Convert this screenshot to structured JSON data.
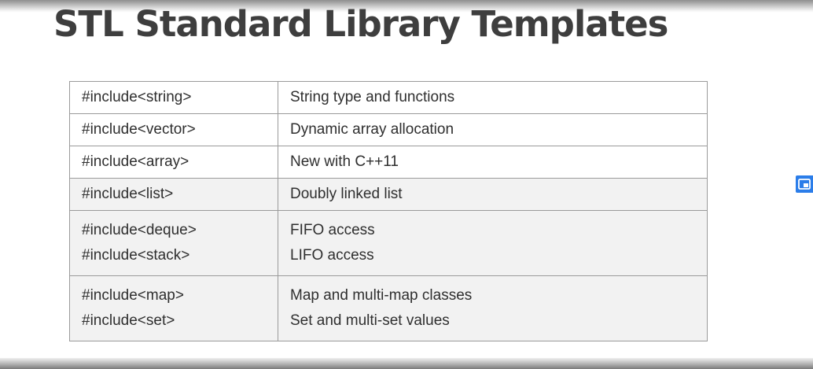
{
  "title": "STL Standard Library Templates",
  "rows": [
    {
      "header": "#include<string>",
      "description": "String type and functions"
    },
    {
      "header": "#include<vector>",
      "description": "Dynamic array allocation"
    },
    {
      "header": "#include<array>",
      "description": "New with C++11"
    },
    {
      "header": "#include<list>",
      "description": "Doubly linked list"
    },
    {
      "headers": [
        "#include<deque>",
        "#include<stack>"
      ],
      "descriptions": [
        "FIFO access",
        "LIFO access"
      ]
    },
    {
      "headers": [
        "#include<map>",
        "#include<set>"
      ],
      "descriptions": [
        "Map and multi-map classes",
        "Set and multi-set values"
      ]
    }
  ],
  "icons": {
    "side_button": "picture-in-picture-icon"
  },
  "colors": {
    "title": "#3e3e3e",
    "text": "#2f2f2f",
    "border": "#9a9a9a",
    "shaded_row": "#f2f2f2",
    "side_button": "#2b7de9"
  }
}
